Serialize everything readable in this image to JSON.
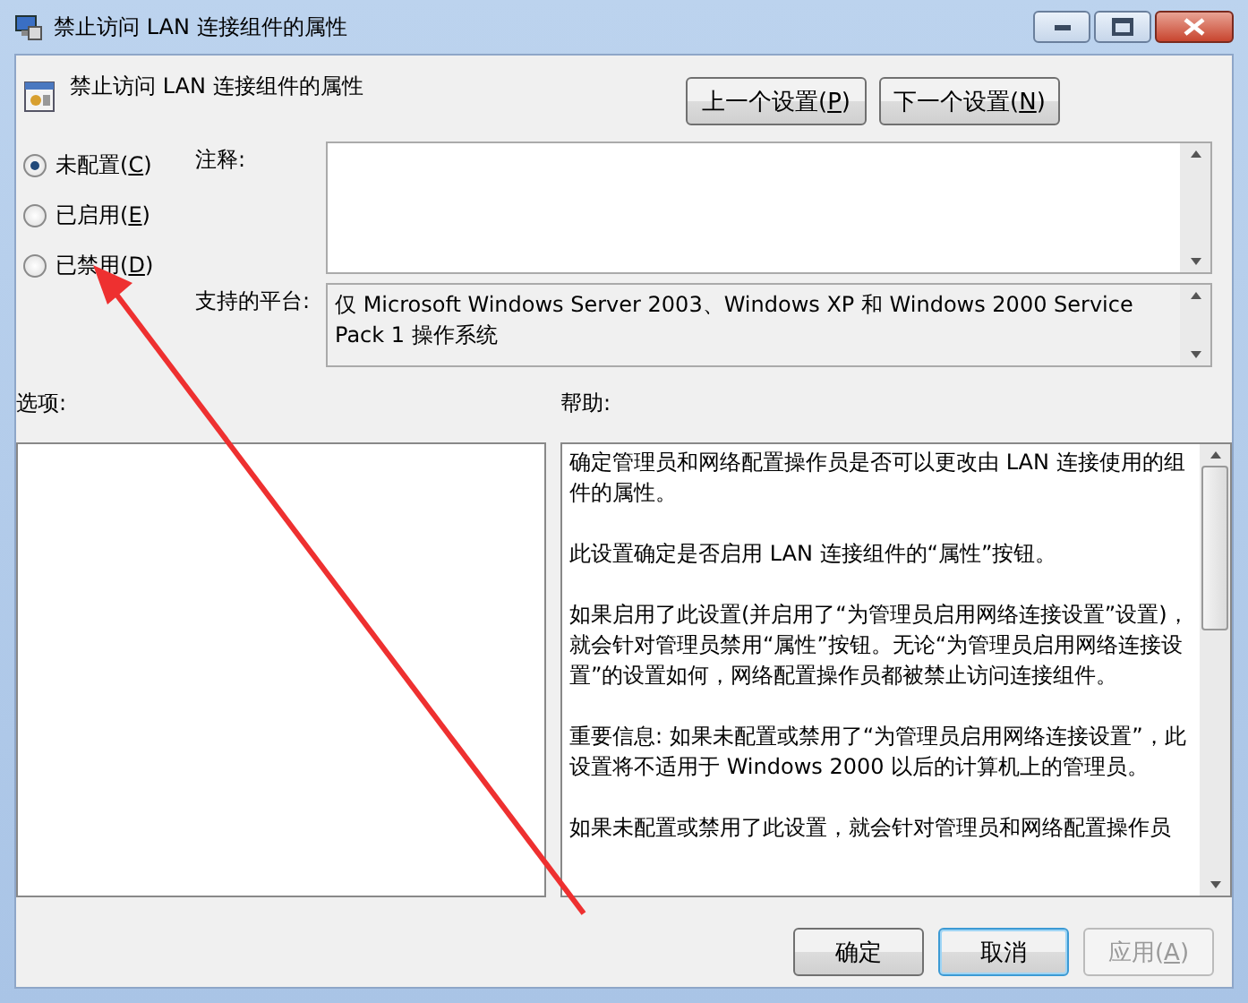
{
  "window": {
    "title": "禁止访问 LAN 连接组件的属性"
  },
  "header": {
    "title": "禁止访问 LAN 连接组件的属性",
    "nav_buttons": [
      {
        "before": "上一个设置(",
        "key": "P",
        "after": ")"
      },
      {
        "before": "下一个设置(",
        "key": "N",
        "after": ")"
      }
    ]
  },
  "state_options": [
    {
      "before": "未配置(",
      "key": "C",
      "after": ")",
      "selected": true
    },
    {
      "before": "已启用(",
      "key": "E",
      "after": ")",
      "selected": false
    },
    {
      "before": "已禁用(",
      "key": "D",
      "after": ")",
      "selected": false
    }
  ],
  "comment": {
    "label": "注释:"
  },
  "platform": {
    "label": "支持的平台:",
    "value": "仅 Microsoft Windows Server 2003、Windows XP 和 Windows 2000 Service Pack 1 操作系统"
  },
  "options": {
    "label": "选项:"
  },
  "help": {
    "label": "帮助:",
    "paragraphs": [
      "确定管理员和网络配置操作员是否可以更改由 LAN 连接使用的组件的属性。",
      "此设置确定是否启用 LAN 连接组件的“属性”按钮。",
      "如果启用了此设置(并启用了“为管理员启用网络连接设置”设置)，就会针对管理员禁用“属性”按钮。无论“为管理员启用网络连接设置”的设置如何，网络配置操作员都被禁止访问连接组件。",
      "重要信息: 如果未配置或禁用了“为管理员启用网络连接设置”，此设置将不适用于 Windows 2000 以后的计算机上的管理员。",
      "如果未配置或禁用了此设置，就会针对管理员和网络配置操作员"
    ]
  },
  "buttons": [
    {
      "before": "确定",
      "focused": false,
      "disabled": false
    },
    {
      "before": "取消",
      "focused": true,
      "disabled": false
    },
    {
      "before": "应用(",
      "key": "A",
      "after": ")",
      "focused": false,
      "disabled": true
    }
  ]
}
